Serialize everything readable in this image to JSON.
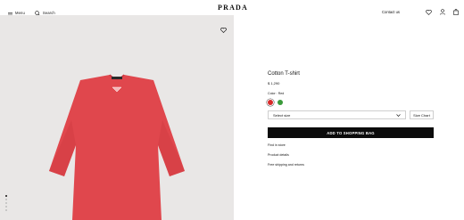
{
  "header": {
    "menu_label": "Menu",
    "search_label": "Search",
    "logo_text": "PRADA",
    "contact_label": "Contact us"
  },
  "product": {
    "title": "Cotton T-shirt",
    "price": "$ 1,290",
    "color_label": "Color",
    "color_value": "Red",
    "swatches": [
      {
        "name": "red",
        "hex": "#d72a2a",
        "selected": true
      },
      {
        "name": "green",
        "hex": "#3a9a3a",
        "selected": false
      }
    ],
    "size_placeholder": "Select size",
    "size_chart_label": "Size Chart",
    "add_to_bag_label": "ADD TO SHOPPING BAG",
    "links": [
      "Find in store",
      "Product details",
      "Free shipping and returns"
    ]
  },
  "gallery": {
    "image_count": 5,
    "active_index": 0,
    "background": "#e9e7e6",
    "product_color": "#e0474d"
  },
  "icons": {
    "menu": "hamburger-icon",
    "search": "search-icon",
    "wishlist": "heart-icon",
    "account": "user-icon",
    "bag": "bag-icon"
  }
}
